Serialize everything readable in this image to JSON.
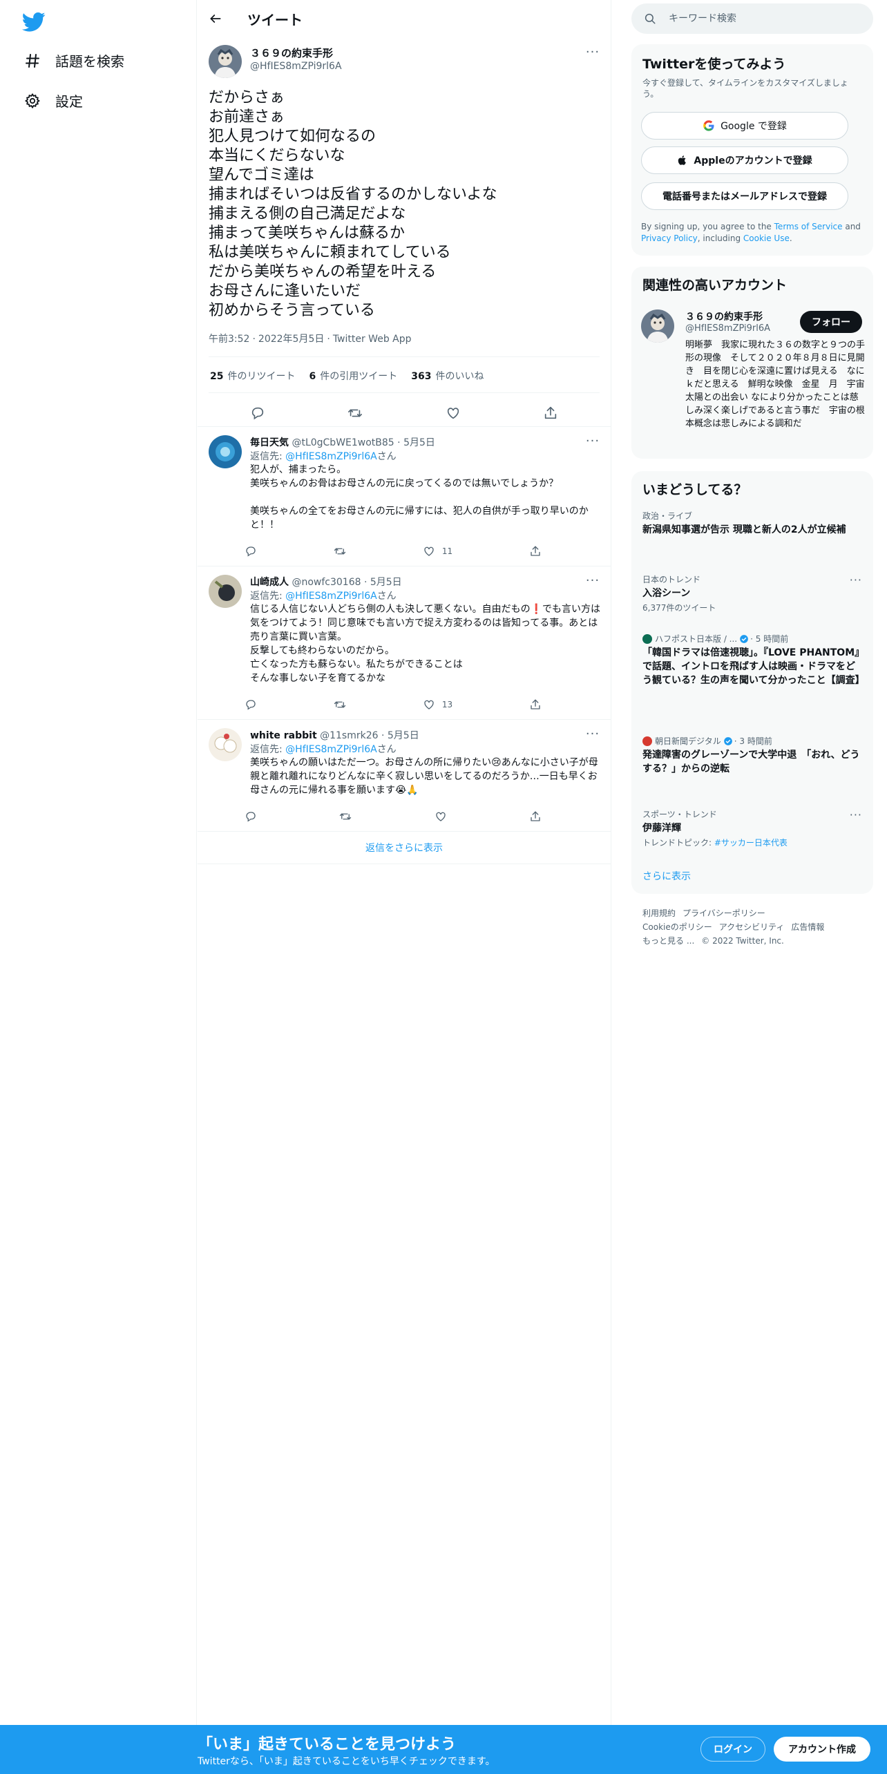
{
  "nav": {
    "items": [
      {
        "label": "話題を検索",
        "icon": "hashtag-icon"
      },
      {
        "label": "設定",
        "icon": "gear-icon"
      }
    ]
  },
  "header": {
    "title": "ツイート"
  },
  "main_tweet": {
    "name": "３６９の約束手形",
    "handle": "@HfIES8mZPi9rl6A",
    "text": "だからさぁ\nお前達さぁ\n犯人見つけて如何なるの\n本当にくだらないな\n望んでゴミ達は\n捕まればそいつは反省するのかしないよな\n捕まえる側の自己満足だよな\n捕まって美咲ちゃんは蘇るか\n私は美咲ちゃんに頼まれてしている\nだから美咲ちゃんの希望を叶える\nお母さんに逢いたいだ\n初めからそう言っている",
    "time": "午前3:52",
    "date": "2022年5月5日",
    "source": "Twitter Web App",
    "sep": "·",
    "retweets_count": "25",
    "retweets_label": "件のリツイート",
    "quotes_count": "6",
    "quotes_label": "件の引用ツイート",
    "likes_count": "363",
    "likes_label": "件のいいね"
  },
  "replies": [
    {
      "name": "毎日天気",
      "handle": "@tL0gCbWE1wotB85",
      "date": "· 5月5日",
      "reply_to_prefix": "返信先: ",
      "reply_to": "@HfIES8mZPi9rl6A",
      "reply_to_suffix": "さん",
      "text": "犯人が、捕まったら。\n美咲ちゃんのお骨はお母さんの元に戻ってくるのでは無いでしょうか？\n\n美咲ちゃんの全てをお母さんの元に帰すには、犯人の自供が手っ取り早いのかと！！",
      "likes": "11"
    },
    {
      "name": "山崎成人",
      "handle": "@nowfc30168",
      "date": "· 5月5日",
      "reply_to_prefix": "返信先: ",
      "reply_to": "@HfIES8mZPi9rl6A",
      "reply_to_suffix": "さん",
      "text": "信じる人信じない人どちら側の人も決して悪くない。自由だもの❗でも言い方は気をつけてよう！同じ意味でも言い方で捉え方変わるのは皆知ってる事。あとは売り言葉に買い言葉。\n反撃しても終わらないのだから。\n亡くなった方も蘇らない。私たちができることは\nそんな事しない子を育てるかな",
      "likes": "13"
    },
    {
      "name": "white rabbit",
      "handle": "@11smrk26",
      "date": "· 5月5日",
      "reply_to_prefix": "返信先: ",
      "reply_to": "@HfIES8mZPi9rl6A",
      "reply_to_suffix": "さん",
      "text": "美咲ちゃんの願いはただ一つ。お母さんの所に帰りたい😢あんなに小さい子が母親と離れ離れになりどんなに辛く寂しい思いをしてるのだろうか…一日も早くお母さんの元に帰れる事を願います😭🙏",
      "likes": ""
    }
  ],
  "show_more_replies": "返信をさらに表示",
  "search": {
    "placeholder": "キーワード検索"
  },
  "signup": {
    "title": "Twitterを使ってみよう",
    "subtitle": "今すぐ登録して、タイムラインをカスタマイズしましょう。",
    "google": "Google で登録",
    "apple": "Appleのアカウントで登録",
    "phone": "電話番号またはメールアドレスで登録",
    "legal_1": "By signing up, you agree to the ",
    "tos": "Terms of Service",
    "legal_2": " and ",
    "privacy": "Privacy Policy",
    "legal_3": ", including ",
    "cookie": "Cookie Use",
    "legal_4": "."
  },
  "related": {
    "title": "関連性の高いアカウント",
    "name": "３６９の約束手形",
    "handle": "@HfIES8mZPi9rl6A",
    "follow": "フォロー",
    "bio": "明晰夢　我家に現れた３６の数字と９つの手形の現像　そして２０２０年８月８日に見開き　目を閉じ心を深遠に置けば見える　なにｋだと思える　鮮明な映像　金星　月　宇宙　太陽との出会い なにより分かったことは慈しみ深く楽しげであると言う事だ　宇宙の根本概念は悲しみによる調和だ"
  },
  "trends": {
    "title": "いまどうしてる？",
    "items": [
      {
        "meta": "政治・ライブ",
        "title": "新潟県知事選が告示 現職と新人の2人が立候補",
        "sub": ""
      },
      {
        "meta": "日本のトレンド",
        "title": "入浴シーン",
        "sub": "6,377件のツイート"
      },
      {
        "meta": "ハフポスト日本版 / ...",
        "time": "· 5 時間前",
        "title": "「韓国ドラマは倍速視聴」。『LOVE PHANTOM』で話題、イントロを飛ばす人は映画・ドラマをどう観ている？生の声を聞いて分かったこと【調査】",
        "sub": ""
      },
      {
        "meta": "朝日新聞デジタル",
        "time": "· 3 時間前",
        "title": "発達障害のグレーゾーンで大学中退　「おれ、どうする？」からの逆転",
        "sub": ""
      },
      {
        "meta": "スポーツ・トレンド",
        "title": "伊藤洋輝",
        "sub_prefix": "トレンドトピック: ",
        "sub_link": "#サッカー日本代表"
      }
    ],
    "show_more": "さらに表示"
  },
  "footer": {
    "links": [
      "利用規約",
      "プライバシーポリシー",
      "Cookieのポリシー",
      "アクセシビリティ",
      "広告情報",
      "もっと見る ..."
    ],
    "copyright": "© 2022 Twitter, Inc."
  },
  "bottom_bar": {
    "title": "「いま」起きていることを見つけよう",
    "subtitle": "Twitterなら、「いま」起きていることをいち早くチェックできます。",
    "login": "ログイン",
    "signup": "アカウント作成"
  },
  "colors": {
    "accent": "#1d9bf0",
    "text": "#0f1419",
    "muted": "#536471",
    "border": "#eff3f4"
  }
}
